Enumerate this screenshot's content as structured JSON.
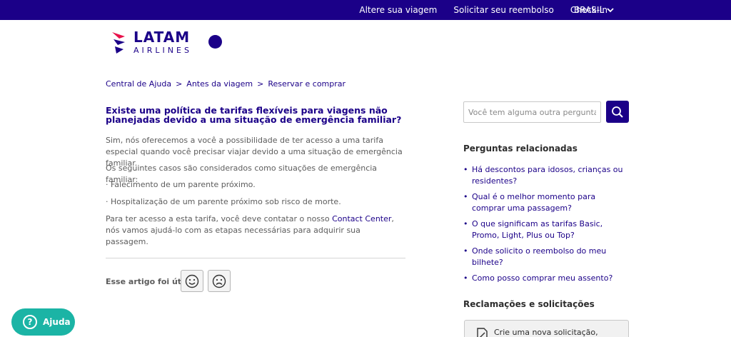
{
  "topnav": {
    "items": [
      "Altere sua viagem",
      "Solicitar seu reembolso",
      "Check-in"
    ],
    "country": "BRASIL"
  },
  "logo": {
    "line1": "LATAM",
    "line2": "AIRLINES"
  },
  "breadcrumb": [
    "Central de Ajuda",
    "Antes da viagem",
    "Reservar e comprar"
  ],
  "article": {
    "title": "Existe uma política de tarifas flexíveis para viagens não planejadas devido a uma situação de emergência familiar?",
    "p1": "Sim, nós oferecemos a você a possibilidade de ter acesso a uma tarifa especial quando você precisar viajar devido a uma situação de emergência familiar.",
    "p2": "Os seguintes casos são considerados como situações de emergência familiar:",
    "p3": "· Falecimento de um parente próximo.",
    "p4": "· Hospitalização de um parente próximo sob risco de morte.",
    "p5_before": "Para ter acesso a esta tarifa, você deve contatar o nosso ",
    "p5_link": "Contact Center",
    "p5_after": ", nós vamos ajudá-lo com as etapas necessárias para adquirir sua passagem.",
    "useful_label": "Esse artigo foi útil?"
  },
  "search": {
    "placeholder": "Você tem alguma outra pergunta?"
  },
  "related": {
    "heading": "Perguntas relacionadas",
    "items": [
      "Há descontos para idosos, crianças ou residentes?",
      "Qual é o melhor momento para comprar uma passagem?",
      "O que significam as tarifas Basic, Promo, Light, Plus ou Top?",
      "Onde solicito o reembolso do meu bilhete?",
      "Como posso comprar meu assento?"
    ]
  },
  "complaints": {
    "heading": "Reclamações e solicitações",
    "card_text": "Crie uma nova solicitação,"
  },
  "help_button": {
    "label": "Ajuda",
    "glyph": "?"
  },
  "colors": {
    "brand": "#1b0088",
    "help": "#1bb4a5",
    "logo_accent": "#e8114b"
  }
}
